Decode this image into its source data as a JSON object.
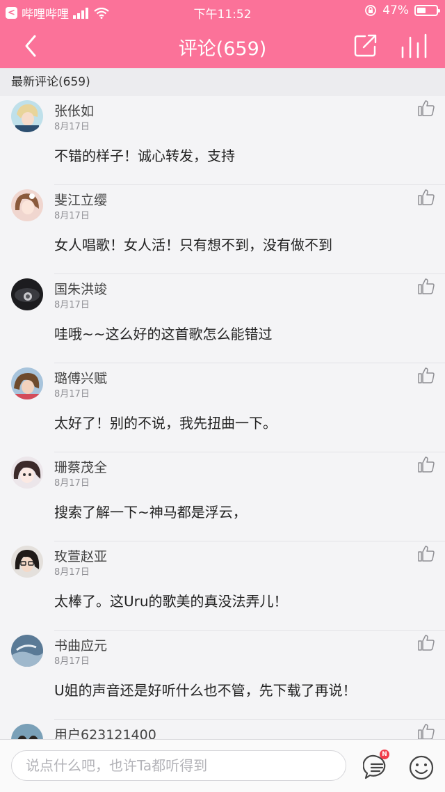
{
  "status_bar": {
    "back_app": "哔哩哔哩",
    "time": "下午11:52",
    "battery": "47%",
    "battery_level": 0.47
  },
  "header": {
    "title": "评论(659)"
  },
  "section": {
    "title": "最新评论(659)"
  },
  "comments": [
    {
      "name": "张伥如",
      "date": "8月17日",
      "text": "不错的样子！诚心转发，支持"
    },
    {
      "name": "斐江立缨",
      "date": "8月17日",
      "text": "女人唱歌！女人活！只有想不到，没有做不到"
    },
    {
      "name": "国朱洪竣",
      "date": "8月17日",
      "text": "哇哦~~这么好的这首歌怎么能错过"
    },
    {
      "name": "璐傅兴赋",
      "date": "8月17日",
      "text": "太好了！别的不说，我先扭曲一下。"
    },
    {
      "name": "珊蔡茂全",
      "date": "8月17日",
      "text": "搜索了解一下~神马都是浮云，"
    },
    {
      "name": "玫萱赵亚",
      "date": "8月17日",
      "text": "太棒了。这Uru的歌美的真没法弄儿！"
    },
    {
      "name": "书曲应元",
      "date": "8月17日",
      "text": "U姐的声音还是好听什么也不管，先下载了再说！"
    },
    {
      "name": "用户623121400",
      "date": "",
      "text": ""
    }
  ],
  "input_bar": {
    "placeholder": "说点什么吧，也许Ta都听得到",
    "badge": "N"
  },
  "colors": {
    "accent": "#fb7299"
  }
}
